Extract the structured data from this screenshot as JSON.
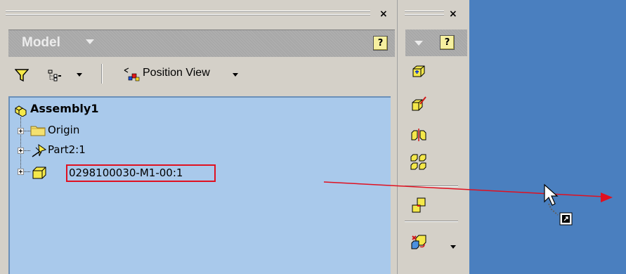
{
  "model_panel": {
    "close_glyph": "×",
    "title": "Model",
    "title_caret_icon": "chevron-down-icon",
    "help_glyph": "?",
    "toolbar": {
      "filter_icon": "filter-icon",
      "display_icon": "tree-display-icon",
      "position_view_label": "Position View"
    },
    "tree": {
      "root": {
        "label": "Assembly1",
        "icon": "assembly-icon"
      },
      "children": [
        {
          "label": "Origin",
          "icon": "folder-icon"
        },
        {
          "label": "Part2:1",
          "icon": "grounded-pin-part-icon"
        },
        {
          "label": "0298100030-M1-00:1",
          "icon": "part-box-icon",
          "highlighted": true
        }
      ]
    }
  },
  "tool_panel": {
    "close_glyph": "×",
    "help_glyph": "?",
    "buttons": [
      "place-component-icon",
      "create-component-icon",
      "mirror-component-icon",
      "pattern-component-icon",
      "constraint-icon",
      "replace-component-icon"
    ]
  },
  "graphics_window": {
    "background": "#4a7fbf",
    "cursor": "drag-shortcut-cursor-icon"
  },
  "colors": {
    "tree_background": "#a9c9eb",
    "highlight_border": "#e01020",
    "arrow": "#e01020",
    "panel_title_bg": "#a8a8a8"
  }
}
